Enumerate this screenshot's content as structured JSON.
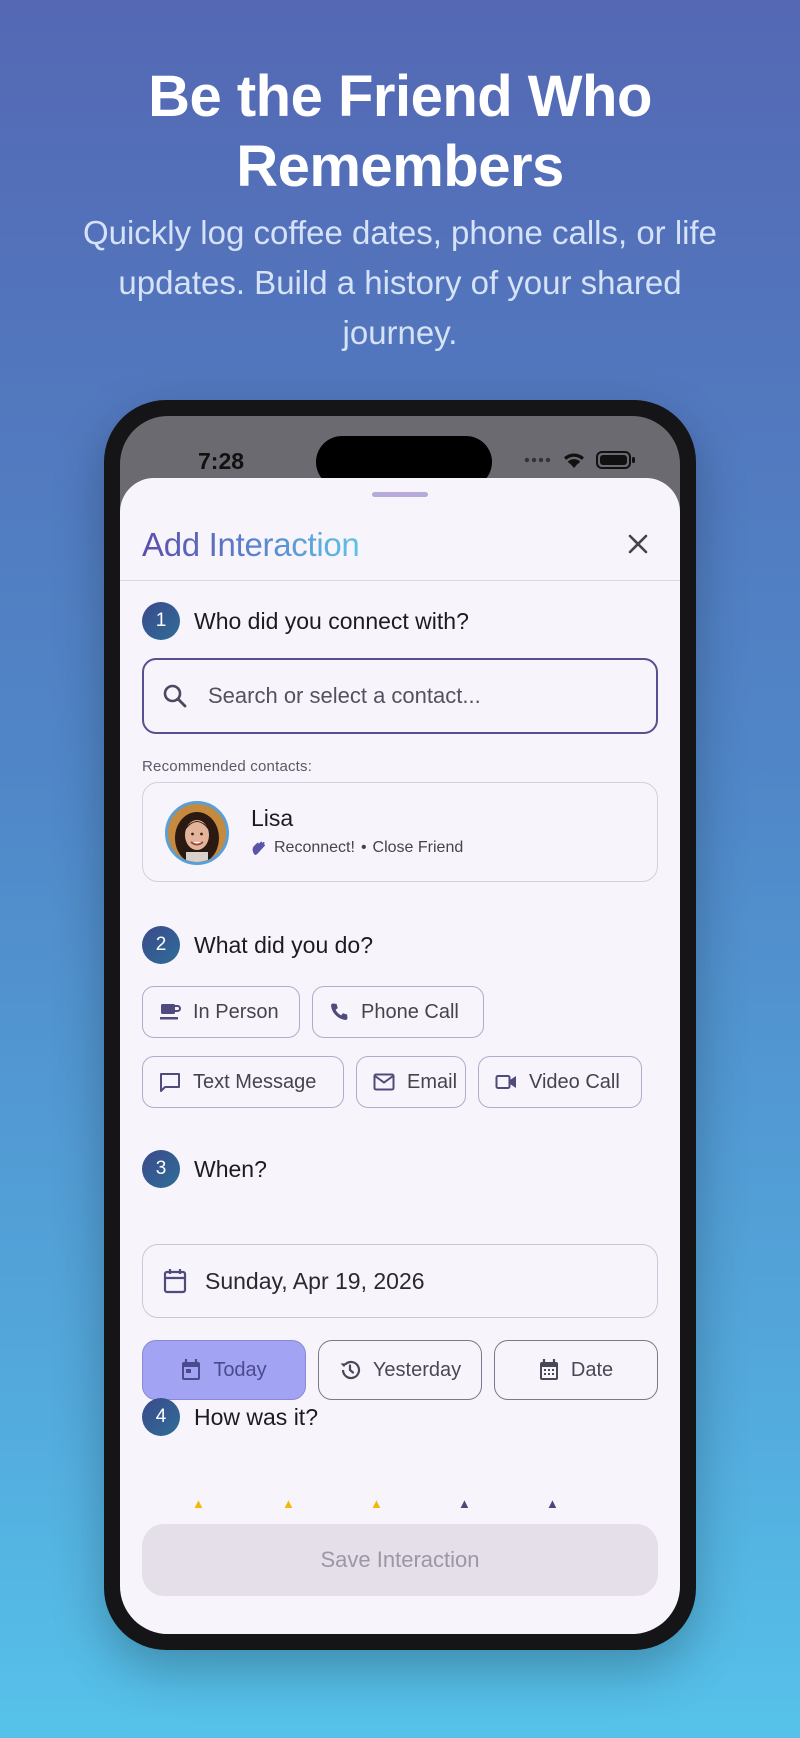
{
  "hero": {
    "title_line1": "Be the Friend Who",
    "title_line2": "Remembers",
    "subtitle": "Quickly log coffee dates, phone calls, or life updates. Build a history of your shared journey."
  },
  "status_bar": {
    "time": "7:28"
  },
  "sheet": {
    "title": "Add Interaction",
    "close_icon": "close-icon"
  },
  "steps": [
    {
      "number": "1",
      "question": "Who did you connect with?"
    },
    {
      "number": "2",
      "question": "What did you do?"
    },
    {
      "number": "3",
      "question": "When?"
    },
    {
      "number": "4",
      "question": "How was it?"
    }
  ],
  "search": {
    "placeholder": "Search or select a contact...",
    "value": ""
  },
  "recommended": {
    "label": "Recommended contacts:",
    "contact": {
      "name": "Lisa",
      "status": "Reconnect!",
      "separator": "•",
      "relation": "Close Friend"
    }
  },
  "activities": [
    {
      "label": "In Person",
      "icon": "coffee-icon"
    },
    {
      "label": "Phone Call",
      "icon": "phone-icon"
    },
    {
      "label": "Text Message",
      "icon": "message-icon"
    },
    {
      "label": "Email",
      "icon": "mail-icon"
    },
    {
      "label": "Video Call",
      "icon": "video-icon"
    }
  ],
  "date": {
    "value": "Sunday, Apr 19, 2026"
  },
  "quick_dates": [
    {
      "label": "Today",
      "selected": true
    },
    {
      "label": "Yesterday",
      "selected": false
    },
    {
      "label": "Date",
      "selected": false
    }
  ],
  "rating": {
    "value": 3,
    "max": 5
  },
  "save": {
    "label": "Save Interaction"
  },
  "colors": {
    "accent": "#a3a3f4",
    "border_active": "#575091",
    "star_on": "#f2b80c",
    "star_off": "#4a477a"
  }
}
